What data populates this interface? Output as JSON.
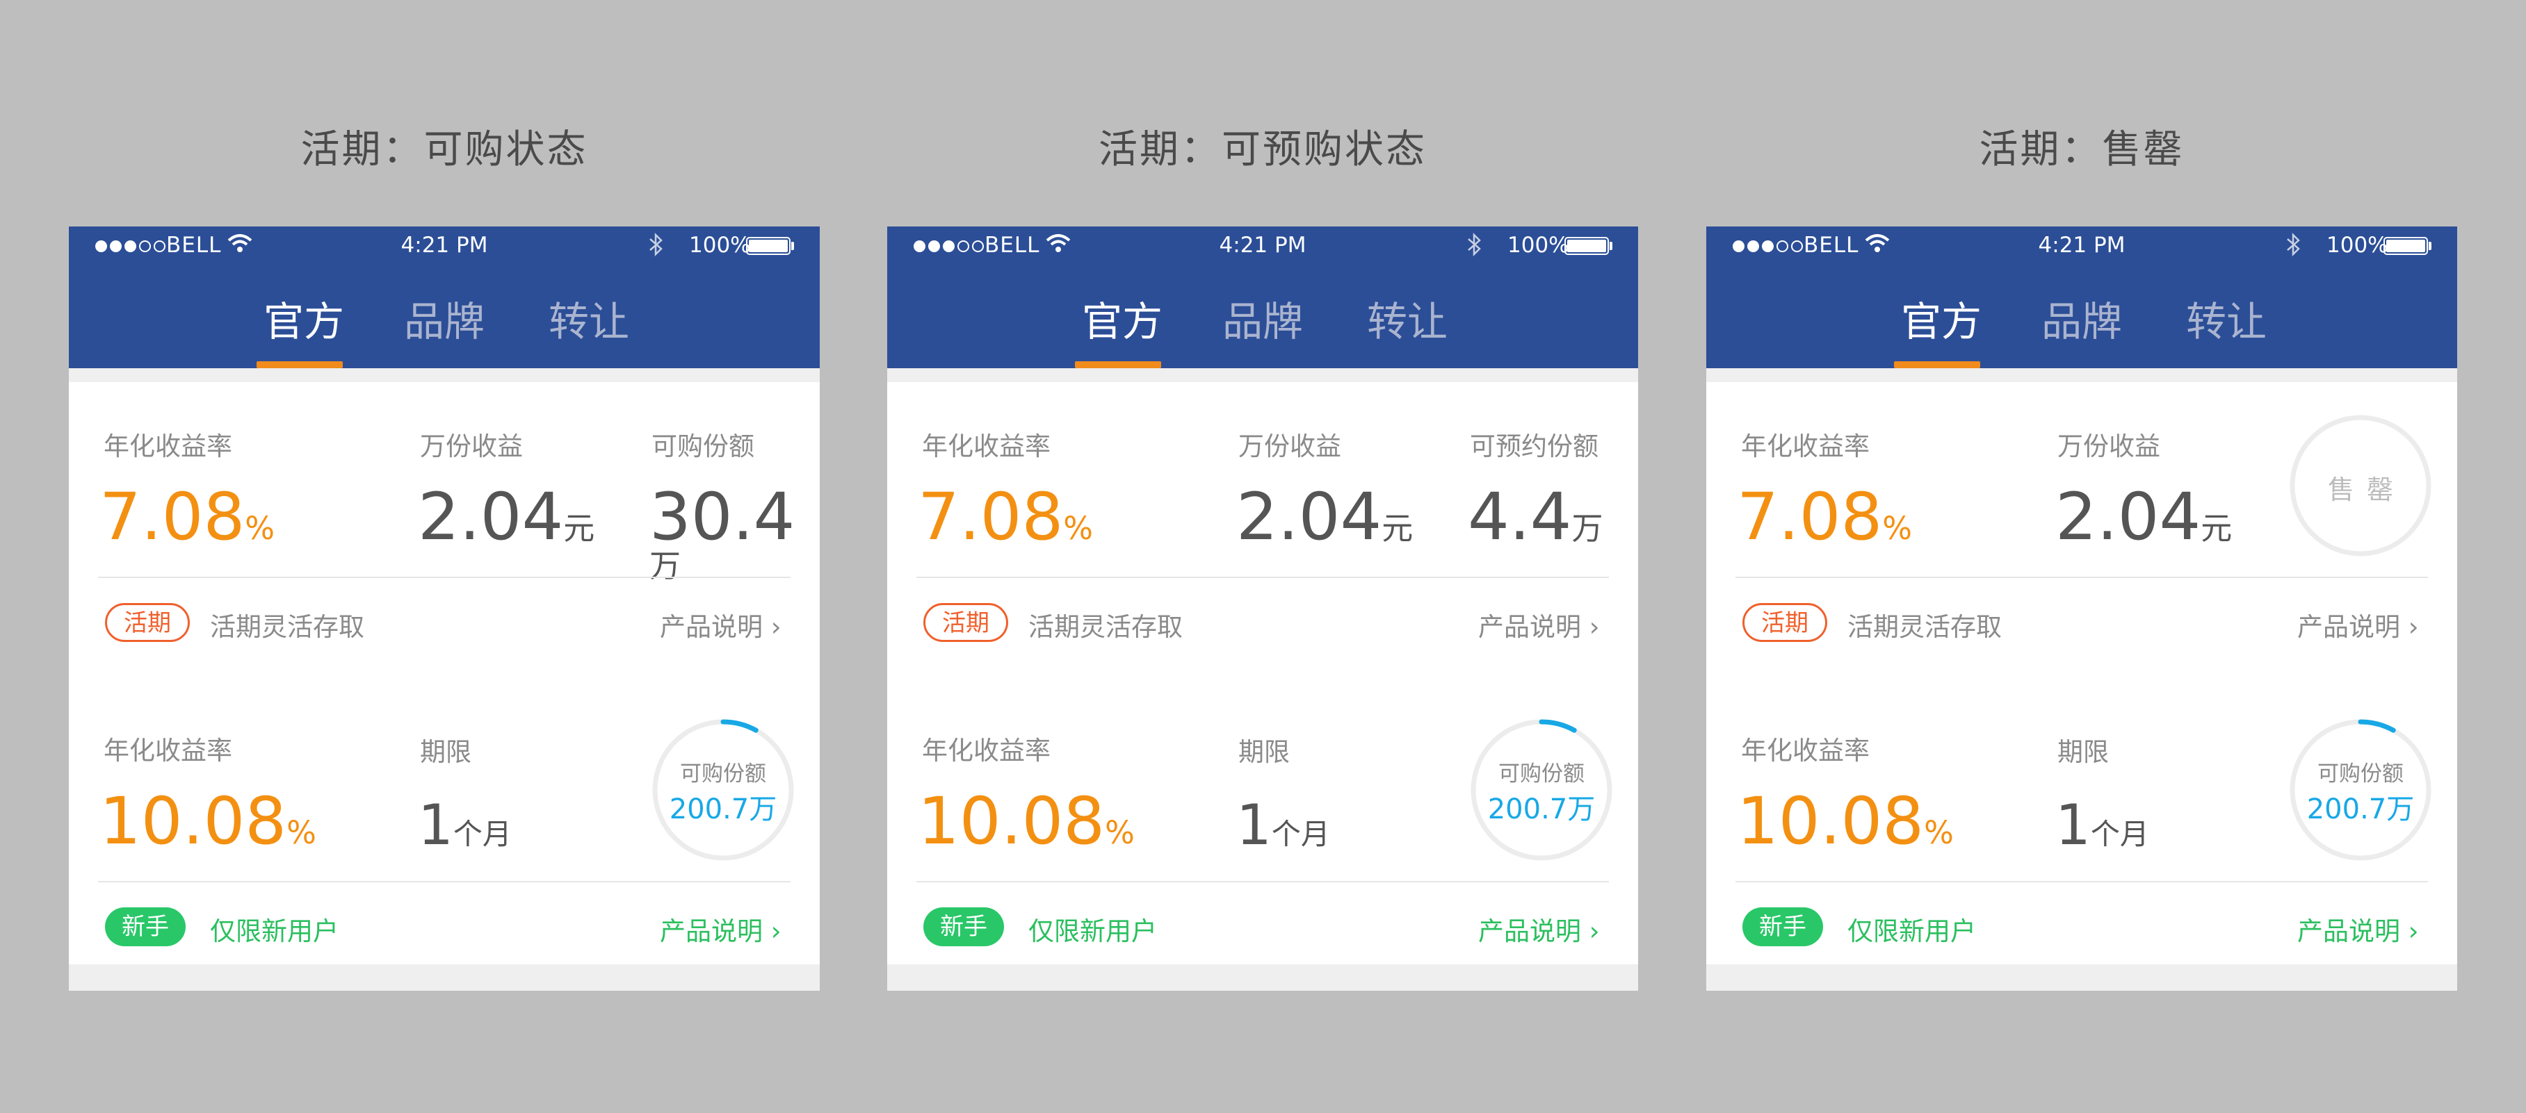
{
  "status_bar": {
    "carrier": "BELL",
    "time": "4:21 PM",
    "battery": "100%"
  },
  "tabs": [
    "官方",
    "品牌",
    "转让"
  ],
  "panels": [
    {
      "title": "活期：可购状态",
      "card1": {
        "rate_label": "年化收益率",
        "rate_value": "7.08",
        "rate_unit": "%",
        "income_label": "万份收益",
        "income_value": "2.04",
        "income_unit": "元",
        "quota_label": "可购份额",
        "quota_value": "30.4",
        "quota_unit": "万",
        "tag": "活期",
        "tag_desc": "活期灵活存取",
        "link": "产品说明"
      },
      "card2": {
        "rate_label": "年化收益率",
        "rate_value": "10.08",
        "rate_unit": "%",
        "term_label": "期限",
        "term_value": "1",
        "term_unit": "个月",
        "ring_label": "可购份额",
        "ring_value": "200.7万",
        "ring_progress": 0.08,
        "tag": "新手",
        "tag_desc": "仅限新用户",
        "link": "产品说明"
      }
    },
    {
      "title": "活期：可预购状态",
      "card1": {
        "rate_label": "年化收益率",
        "rate_value": "7.08",
        "rate_unit": "%",
        "income_label": "万份收益",
        "income_value": "2.04",
        "income_unit": "元",
        "quota_label": "可预约份额",
        "quota_value": "4.4",
        "quota_unit": "万",
        "tag": "活期",
        "tag_desc": "活期灵活存取",
        "link": "产品说明"
      },
      "card2": {
        "rate_label": "年化收益率",
        "rate_value": "10.08",
        "rate_unit": "%",
        "term_label": "期限",
        "term_value": "1",
        "term_unit": "个月",
        "ring_label": "可购份额",
        "ring_value": "200.7万",
        "ring_progress": 0.08,
        "tag": "新手",
        "tag_desc": "仅限新用户",
        "link": "产品说明"
      }
    },
    {
      "title": "活期：售罄",
      "card1": {
        "rate_label": "年化收益率",
        "rate_value": "7.08",
        "rate_unit": "%",
        "income_label": "万份收益",
        "income_value": "2.04",
        "income_unit": "元",
        "soldout": "售罄",
        "tag": "活期",
        "tag_desc": "活期灵活存取",
        "link": "产品说明"
      },
      "card2": {
        "rate_label": "年化收益率",
        "rate_value": "10.08",
        "rate_unit": "%",
        "term_label": "期限",
        "term_value": "1",
        "term_unit": "个月",
        "ring_label": "可购份额",
        "ring_value": "200.7万",
        "ring_progress": 0.08,
        "tag": "新手",
        "tag_desc": "仅限新用户",
        "link": "产品说明"
      }
    }
  ],
  "colors": {
    "header": "#2c4e97",
    "accent_orange": "#f39012",
    "tab_underline": "#f18b1c",
    "tag_red": "#f0602c",
    "green": "#29c768",
    "ring_blue": "#18a8e6",
    "background": "#bebebe"
  },
  "icons": [
    "signal-dots-icon",
    "wifi-icon",
    "bluetooth-icon",
    "battery-icon",
    "chevron-right-icon"
  ]
}
